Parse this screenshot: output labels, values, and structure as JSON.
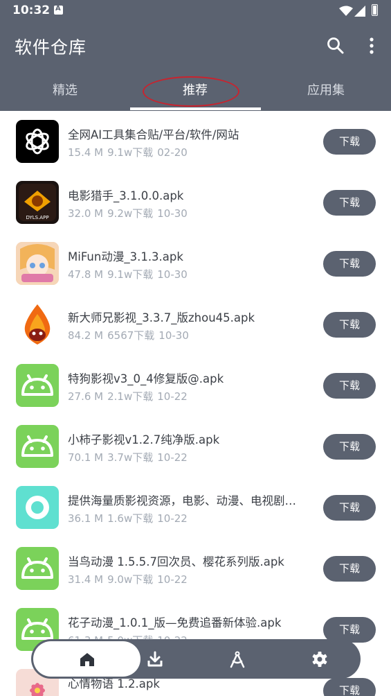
{
  "status_bar": {
    "time": "10:32"
  },
  "app_title": "软件仓库",
  "tabs": [
    {
      "label": "精选"
    },
    {
      "label": "推荐"
    },
    {
      "label": "应用集"
    }
  ],
  "active_tab": "推荐",
  "download_label": "下载",
  "apps": [
    {
      "name": "全网AI工具集合贴/平台/软件/网站",
      "size": "15.4 M",
      "downloads": "9.1w下载",
      "date": "02-20",
      "icon": "openai-logo-icon"
    },
    {
      "name": "电影猎手_3.1.0.0.apk",
      "size": "32.0 M",
      "downloads": "9.2w下载",
      "date": "10-30",
      "icon": "movie-hunter-icon",
      "icon_text": "DYLS.APP"
    },
    {
      "name": "MiFun动漫_3.1.3.apk",
      "size": "47.8 M",
      "downloads": "9.1w下载",
      "date": "10-30",
      "icon": "anime-girl-icon"
    },
    {
      "name": "新大师兄影视_3.3.7_版zhou45.apk",
      "size": "84.2 M",
      "downloads": "6567下载",
      "date": "10-30",
      "icon": "flame-monkey-icon"
    },
    {
      "name": "特狗影视v3_0_4修复版@.apk",
      "size": "27.6 M",
      "downloads": "2.1w下载",
      "date": "10-22",
      "icon": "android-icon"
    },
    {
      "name": "小柿子影视v1.2.7纯净版.apk",
      "size": "70.1 M",
      "downloads": "3.7w下载",
      "date": "10-22",
      "icon": "android-icon"
    },
    {
      "name": "提供海量质影视资源，电影、动漫、电视剧…",
      "size": "36.1 M",
      "downloads": "1.6w下载",
      "date": "10-22",
      "icon": "teal-ring-icon"
    },
    {
      "name": "当鸟动漫 1.5.5.7回次员、樱花系列版.apk",
      "size": "31.4 M",
      "downloads": "9.0w下载",
      "date": "10-22",
      "icon": "android-icon"
    },
    {
      "name": "花子动漫_1.0.1_版—免费追番新体验.apk",
      "size": "61.3 M",
      "downloads": "5.0w下载",
      "date": "10-22",
      "icon": "android-icon"
    },
    {
      "name": "心情物语 1.2.apk",
      "size": "",
      "downloads": "",
      "date": "",
      "icon": "flower-icon"
    }
  ],
  "bottom_nav": [
    {
      "name": "home",
      "icon": "home-icon",
      "active": true
    },
    {
      "name": "downloads",
      "icon": "download-icon",
      "active": false
    },
    {
      "name": "tools",
      "icon": "compass-icon",
      "active": false
    },
    {
      "name": "settings",
      "icon": "gear-icon",
      "active": false
    }
  ],
  "colors": {
    "primary": "#5b6270",
    "android_green": "#7bd25a",
    "highlight_circle": "#c9232e",
    "text": "#3b3f46",
    "meta": "#a3aab4"
  }
}
